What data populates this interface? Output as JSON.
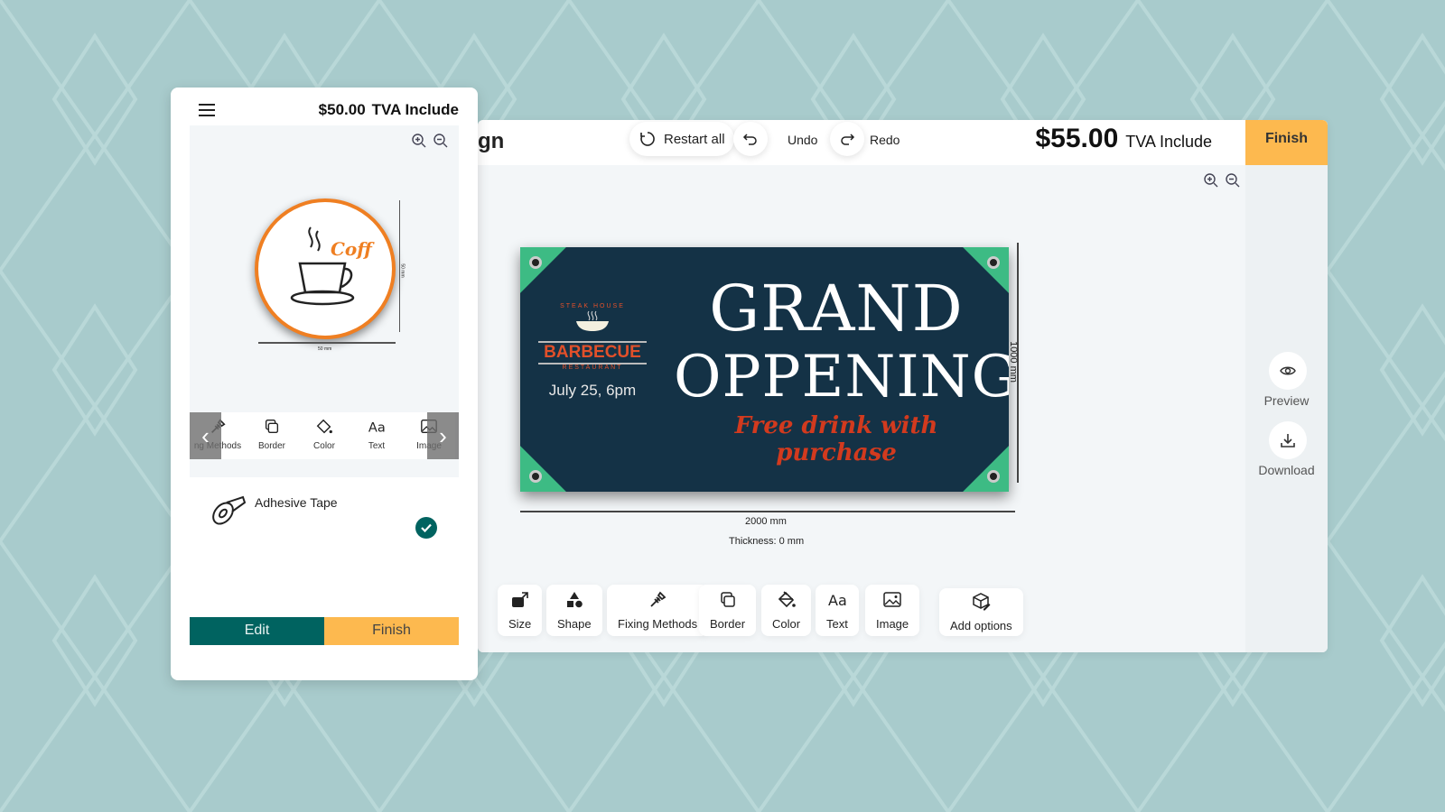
{
  "colors": {
    "background": "#a8cbcc",
    "accent_finish": "#fdb94f",
    "accent_edit": "#006360",
    "sign_bg": "#143246",
    "sign_corner": "#3dbb84",
    "sign_script": "#d23a1e"
  },
  "desktop": {
    "title_fragment": "gn",
    "restart_label": "Restart all",
    "undo_label": "Undo",
    "redo_label": "Redo",
    "price": "$55.00",
    "tax_label": "TVA Include",
    "finish_label": "Finish",
    "preview_label": "Preview",
    "download_label": "Download",
    "sign": {
      "headline_1": "GRAND",
      "headline_2": "OPPENING",
      "tagline": "Free drink with purchase",
      "logo_top": "STEAK HOUSE",
      "logo_main": "BARBECUE",
      "logo_bottom": "RESTAURANT",
      "date": "July 25, 6pm"
    },
    "height_label": "1000 mm",
    "width_label": "2000 mm",
    "thickness_label": "Thickness: 0 mm",
    "toolbar": [
      {
        "label": "Size",
        "icon": "resize-icon"
      },
      {
        "label": "Shape",
        "icon": "shapes-icon"
      },
      {
        "label": "Fixing Methods",
        "icon": "screw-icon"
      },
      {
        "label": "Border",
        "icon": "border-icon"
      },
      {
        "label": "Color",
        "icon": "paint-bucket-icon"
      },
      {
        "label": "Text",
        "icon": "text-icon"
      },
      {
        "label": "Image",
        "icon": "image-icon"
      },
      {
        "label": "Add options",
        "icon": "box-edit-icon"
      }
    ]
  },
  "mobile": {
    "price": "$50.00",
    "tax_label": "TVA Include",
    "coaster_text": "Coff",
    "width_label": "50 mm",
    "height_label": "50 mm",
    "toolbar": [
      {
        "label": "ng Methods"
      },
      {
        "label": "Border"
      },
      {
        "label": "Color"
      },
      {
        "label": "Text"
      },
      {
        "label": "Image"
      }
    ],
    "option_label": "Adhesive Tape",
    "option_selected": true,
    "edit_label": "Edit",
    "finish_label": "Finish"
  }
}
